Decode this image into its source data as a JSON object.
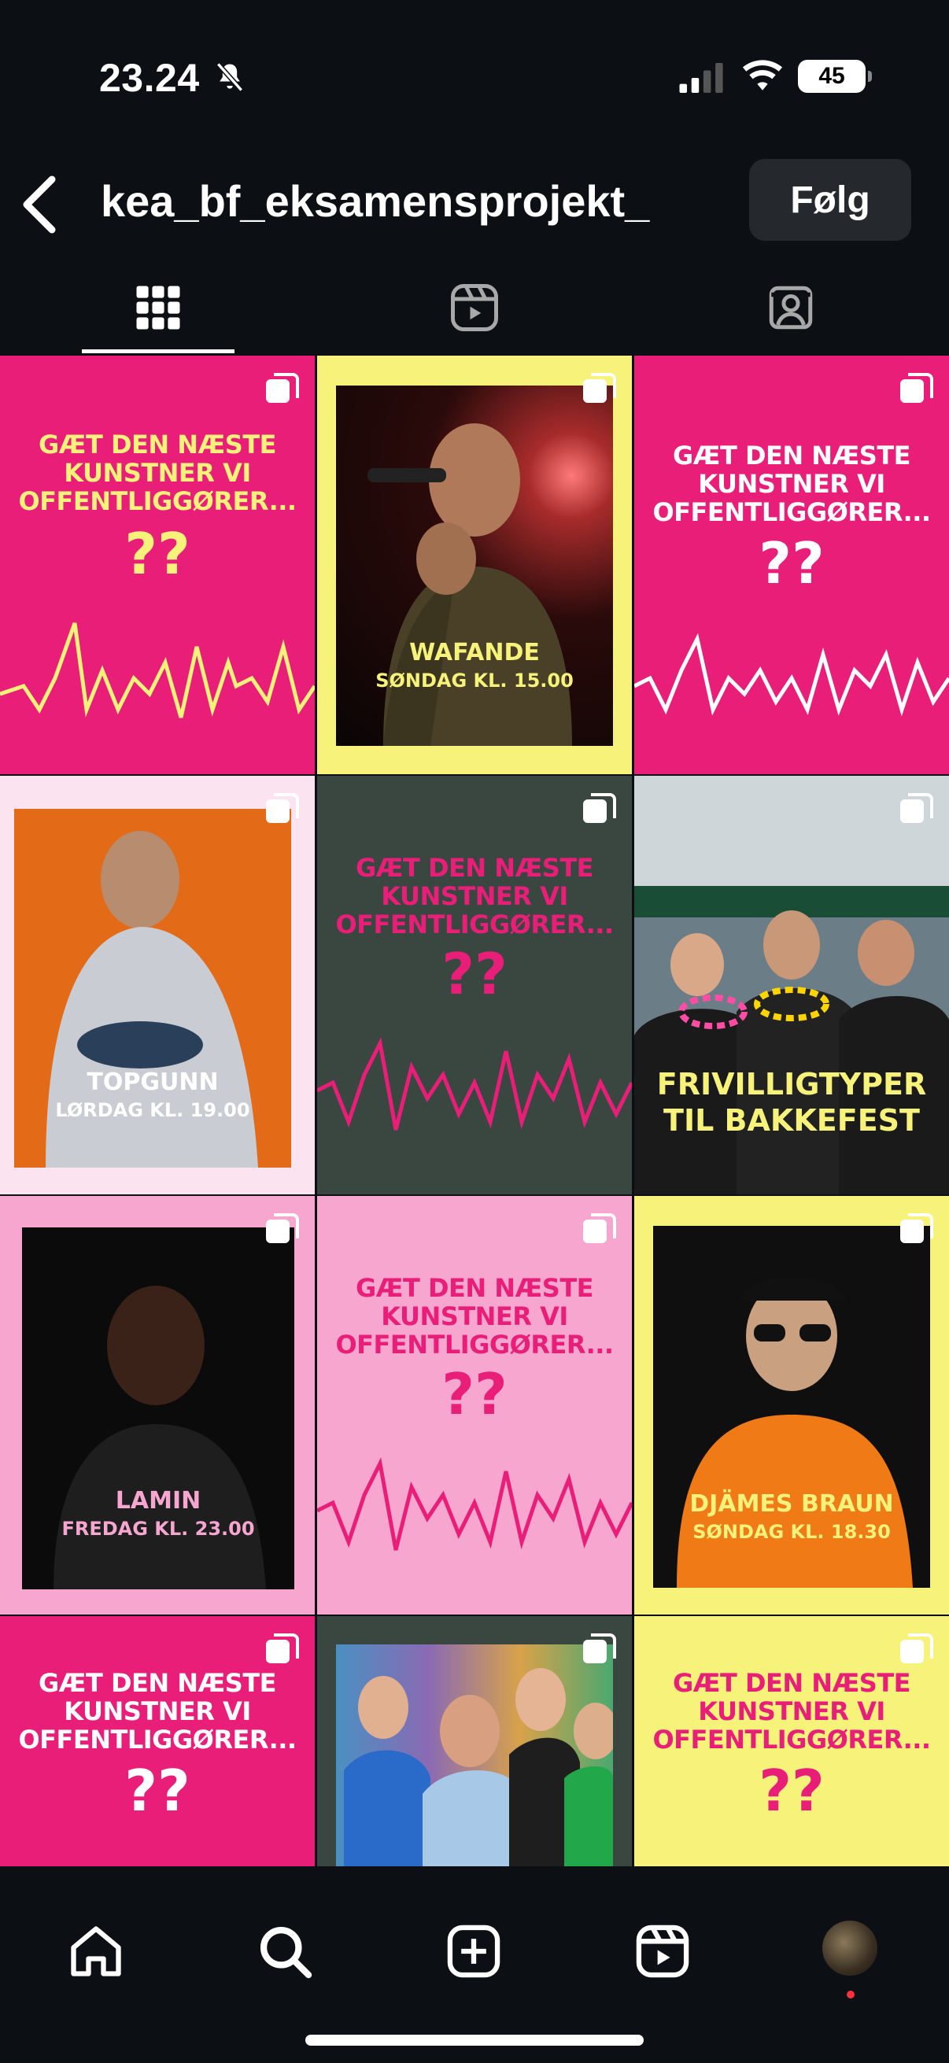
{
  "status_bar": {
    "time": "23.24",
    "battery": "45",
    "icons": [
      "bell-slash-icon",
      "signal-icon",
      "wifi-icon",
      "battery-icon"
    ]
  },
  "header": {
    "username": "kea_bf_eksamensprojekt_",
    "follow_label": "Følg",
    "back_icon": "chevron-left-icon"
  },
  "tabs": [
    {
      "name": "grid",
      "icon": "grid-icon",
      "active": true
    },
    {
      "name": "reels",
      "icon": "reels-icon",
      "active": false
    },
    {
      "name": "tagged",
      "icon": "tagged-icon",
      "active": false
    }
  ],
  "colors": {
    "pink": "#e91e79",
    "yellow": "#f7f27a",
    "dark_green": "#3a4640",
    "light_pink": "#f7a6d0",
    "bg": "#0c1014"
  },
  "posts": {
    "p1": {
      "line1": "GÆT DEN NÆSTE",
      "line2": "KUNSTNER VI",
      "line3": "OFFENTLIGGØRER...",
      "mark": "??"
    },
    "p2": {
      "name": "WAFANDE",
      "time": "SØNDAG KL. 15.00"
    },
    "p3": {
      "line1": "GÆT DEN NÆSTE",
      "line2": "KUNSTNER VI",
      "line3": "OFFENTLIGGØRER...",
      "mark": "??"
    },
    "p4": {
      "name": "TOPGUNN",
      "time": "LØRDAG KL. 19.00"
    },
    "p5": {
      "line1": "GÆT DEN NÆSTE",
      "line2": "KUNSTNER VI",
      "line3": "OFFENTLIGGØRER...",
      "mark": "??"
    },
    "p6": {
      "line1": "FRIVILLIGTYPER",
      "line2": "TIL BAKKEFEST"
    },
    "p7": {
      "name": "LAMIN",
      "time": "FREDAG KL. 23.00"
    },
    "p8": {
      "line1": "GÆT DEN NÆSTE",
      "line2": "KUNSTNER VI",
      "line3": "OFFENTLIGGØRER...",
      "mark": "??"
    },
    "p9": {
      "name": "DJÄMES BRAUN",
      "time": "SØNDAG KL. 18.30"
    },
    "p10": {
      "line1": "GÆT DEN NÆSTE",
      "line2": "KUNSTNER VI",
      "line3": "OFFENTLIGGØRER...",
      "mark": "??"
    },
    "p11": {},
    "p12": {
      "line1": "GÆT DEN NÆSTE",
      "line2": "KUNSTNER VI",
      "line3": "OFFENTLIGGØRER...",
      "mark": "??"
    }
  },
  "bottom_nav": {
    "items": [
      "home-icon",
      "search-icon",
      "create-icon",
      "reels-icon",
      "profile-avatar"
    ]
  }
}
